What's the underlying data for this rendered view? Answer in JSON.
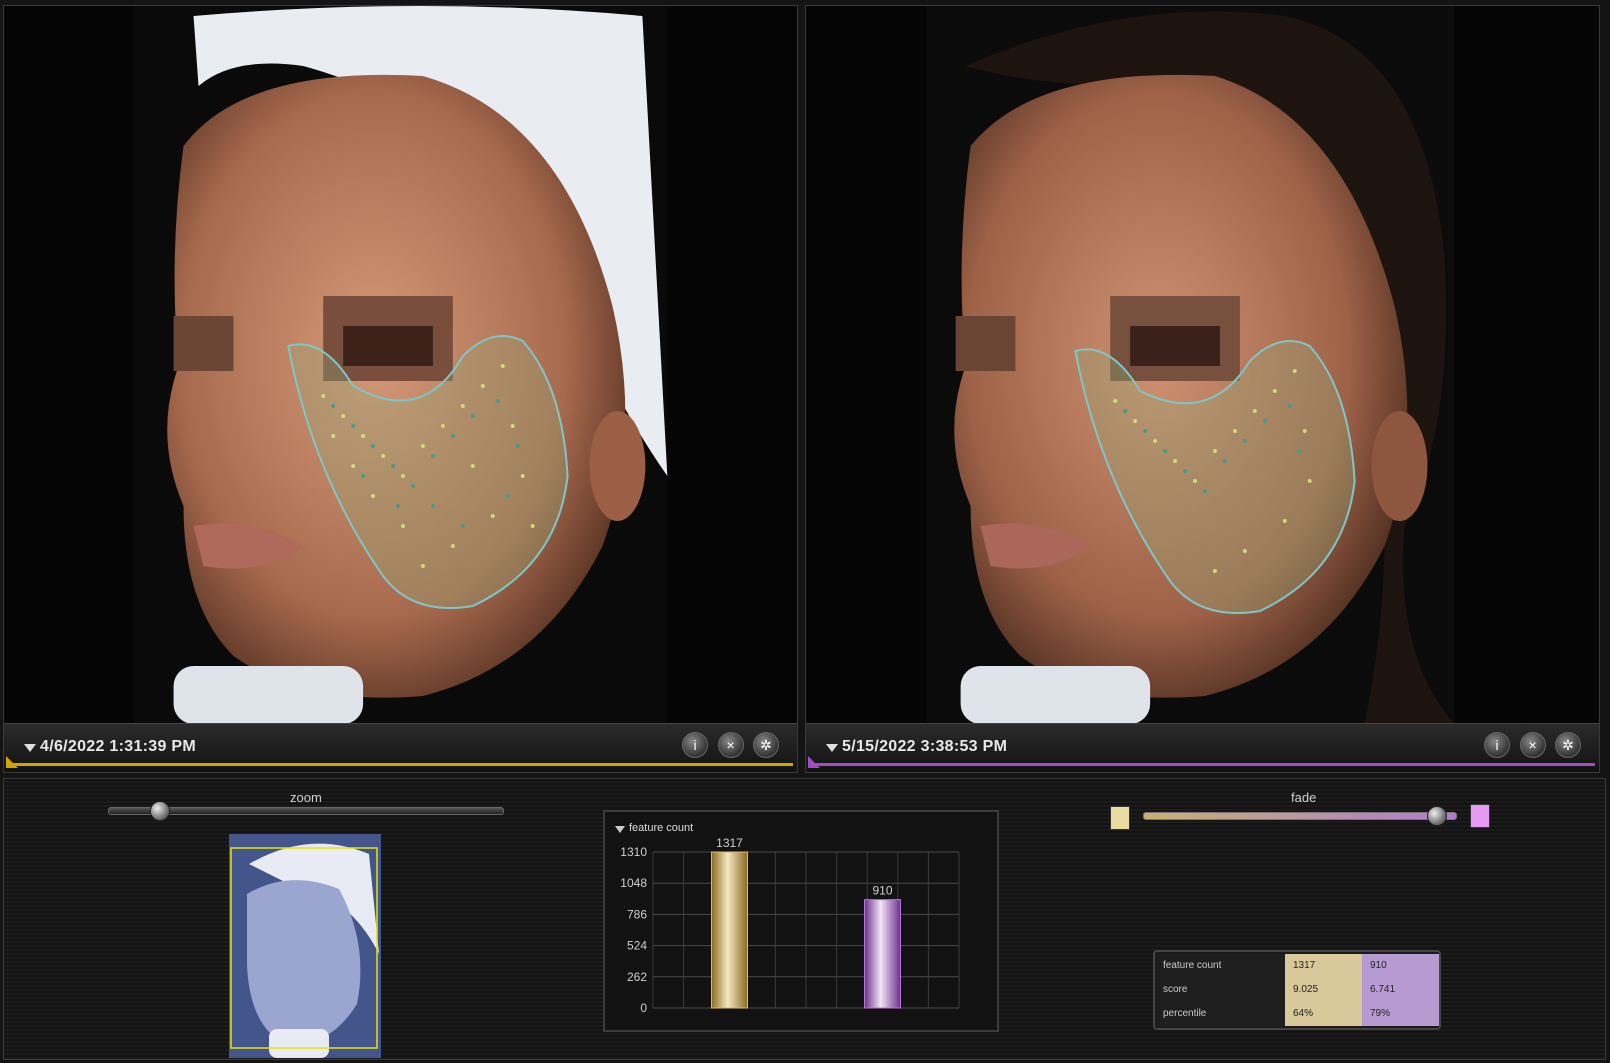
{
  "left_pane": {
    "date": "4/6/2022 1:31:39 PM",
    "accent": "#d4a300"
  },
  "right_pane": {
    "date": "5/15/2022 3:38:53 PM",
    "accent": "#a24bc6"
  },
  "toolbar_icons": [
    "info-icon",
    "close-icon",
    "settings-icon"
  ],
  "controls": {
    "zoom_label": "zoom",
    "zoom_value": 0.13,
    "fade_label": "fade",
    "fade_value": 0.94
  },
  "chart_data": {
    "type": "bar",
    "title": "feature count",
    "categories": [
      "4/6/2022 1:31:39 PM",
      "5/15/2022 3:38:53 PM"
    ],
    "values": [
      1317,
      910
    ],
    "ylim": [
      0,
      1310
    ],
    "yticks": [
      0,
      262,
      524,
      786,
      1048,
      1310
    ],
    "colors": [
      "#d8bc6a",
      "#b47ad0"
    ],
    "grid": true
  },
  "metrics": {
    "rows": [
      {
        "label": "feature count",
        "left": "1317",
        "right": "910"
      },
      {
        "label": "score",
        "left": "9.025",
        "right": "6.741"
      },
      {
        "label": "percentile",
        "left": "64%",
        "right": "79%"
      }
    ],
    "left_color": "#d9c89a",
    "right_color": "#b79ad1"
  }
}
